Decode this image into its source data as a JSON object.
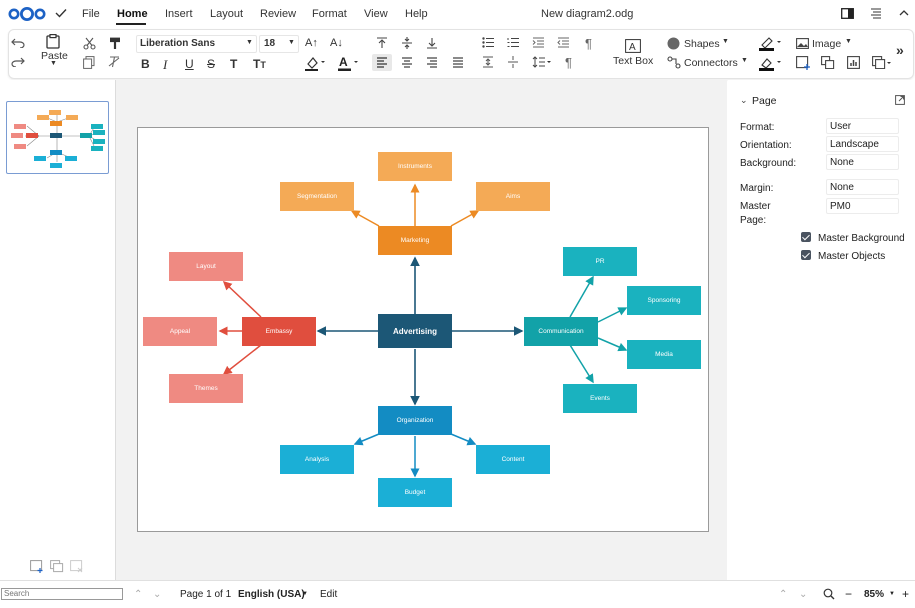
{
  "app": {
    "document_title": "New diagram2.odg"
  },
  "menubar": {
    "file": "File",
    "home": "Home",
    "insert": "Insert",
    "layout": "Layout",
    "review": "Review",
    "format": "Format",
    "view": "View",
    "help": "Help"
  },
  "toolbar": {
    "paste_label": "Paste",
    "font_name": "Liberation Sans",
    "font_size": "18",
    "text_box_label": "Text Box",
    "shapes_label": "Shapes",
    "connectors_label": "Connectors",
    "image_label": "Image"
  },
  "deck": {
    "title": "Page",
    "format_label": "Format:",
    "format_value": "User",
    "orientation_label": "Orientation:",
    "orientation_value": "Landscape",
    "background_label": "Background:",
    "background_value": "None",
    "margin_label": "Margin:",
    "margin_value": "None",
    "master_page_label_1": "Master",
    "master_page_label_2": "Page:",
    "master_page_value": "PM0",
    "master_background_label": "Master Background",
    "master_objects_label": "Master Objects"
  },
  "statusbar": {
    "search_placeholder": "Search",
    "page_info": "Page 1 of 1",
    "language": "English (USA)",
    "mode": "Edit",
    "zoom": "85%"
  },
  "diagram": {
    "center": "Advertising",
    "marketing": "Marketing",
    "instruments": "Instruments",
    "segmentation": "Segmentation",
    "aims": "Aims",
    "embassy": "Embassy",
    "layout": "Layout",
    "appeal": "Appeal",
    "themes": "Themes",
    "communication": "Communication",
    "pr": "PR",
    "sponsoring": "Sponsoring",
    "media": "Media",
    "events": "Events",
    "organization": "Organization",
    "analysis": "Analysis",
    "content": "Content",
    "budget": "Budget"
  },
  "colors": {
    "center": "#1c5776",
    "marketing": "#ec8a23",
    "marketing_light": "#f4aa56",
    "embassy": "#e04e3e",
    "embassy_light": "#ef8a82",
    "communication": "#12a2a8",
    "communication_light": "#1ab2bf",
    "organization": "#138cc3",
    "organization_light": "#1bafd6",
    "accent": "#1d62c5"
  }
}
